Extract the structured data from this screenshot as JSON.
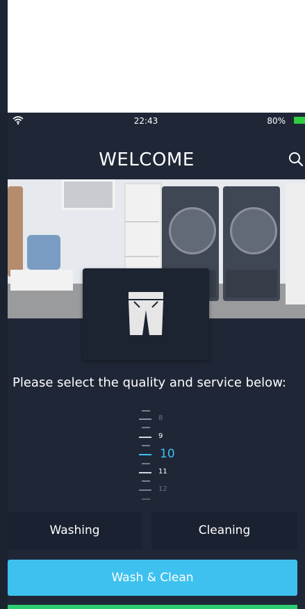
{
  "status_bar": {
    "time": "22:43",
    "battery": "80%",
    "wifi_icon": "wifi-icon",
    "battery_icon": "battery-icon"
  },
  "header": {
    "title": "WELCOME",
    "search_icon": "search-icon"
  },
  "hero": {
    "description_icon": "laundry-room-photo"
  },
  "category": {
    "icon": "jeans-icon"
  },
  "prompt": "Please select the quality and service below:",
  "picker": {
    "values": [
      "8",
      "9",
      "10",
      "11",
      "12"
    ],
    "selected": "10",
    "accent_color": "#3ec1ef"
  },
  "options": {
    "washing_label": "Washing",
    "cleaning_label": "Cleaning"
  },
  "actions": {
    "primary_label": "Wash & Clean"
  },
  "colors": {
    "background": "#1f2737",
    "accent": "#3ec1ef",
    "battery": "#2ecc40",
    "secondary_action": "#2ecc71"
  }
}
